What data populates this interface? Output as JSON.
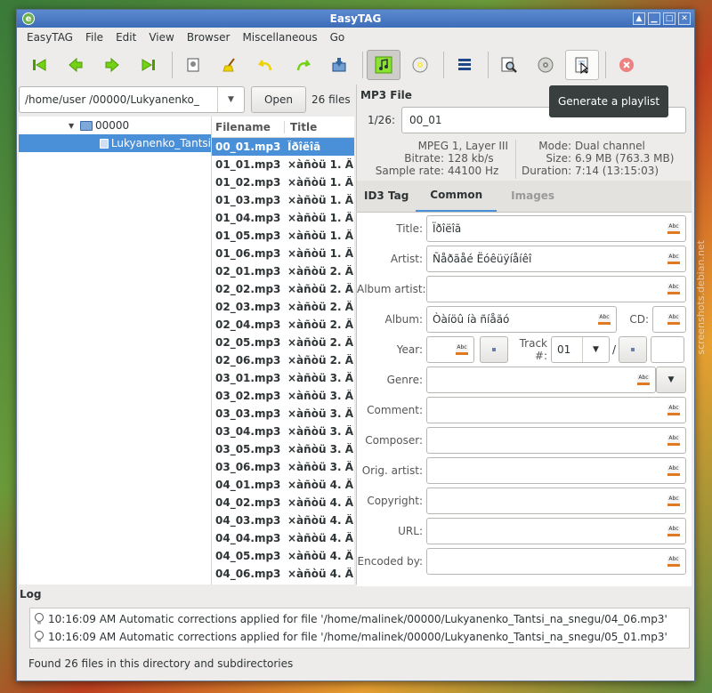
{
  "window": {
    "title": "EasyTAG",
    "app_icon_letter": "e"
  },
  "wm_buttons": {
    "up": "▲",
    "minimize": "▁",
    "maximize": "□",
    "close": "✕"
  },
  "menubar": [
    "EasyTAG",
    "File",
    "Edit",
    "View",
    "Browser",
    "Miscellaneous",
    "Go"
  ],
  "toolbar": {
    "icons": [
      "go-first-icon",
      "go-previous-icon",
      "go-next-icon",
      "go-last-icon",
      "scan-files-icon",
      "clear-icon",
      "undo-icon",
      "redo-icon",
      "save-icon",
      "view-artist-album-icon",
      "cddb-icon",
      "invert-selection-icon",
      "search-icon",
      "cd-icon",
      "playlist-icon",
      "stop-icon"
    ],
    "tooltip": "Generate a playlist"
  },
  "browser": {
    "path": "/home/user  /00000/Lukyanenko_",
    "open_label": "Open",
    "files_count": "26 files",
    "tree": [
      {
        "label": "00000",
        "expanded": true,
        "level": 0
      },
      {
        "label": "Lukyanenko_Tantsi",
        "level": 1,
        "selected": true
      }
    ],
    "list_headers": {
      "filename": "Filename",
      "title": "Title"
    },
    "files": [
      {
        "name": "00_01.mp3",
        "title": "Ïðîëîã",
        "selected": true
      },
      {
        "name": "01_01.mp3",
        "title": "×àñòü 1. Ä"
      },
      {
        "name": "01_02.mp3",
        "title": "×àñòü 1. Ä"
      },
      {
        "name": "01_03.mp3",
        "title": "×àñòü 1. Ä"
      },
      {
        "name": "01_04.mp3",
        "title": "×àñòü 1. Ä"
      },
      {
        "name": "01_05.mp3",
        "title": "×àñòü 1. Ä"
      },
      {
        "name": "01_06.mp3",
        "title": "×àñòü 1. Ä"
      },
      {
        "name": "02_01.mp3",
        "title": "×àñòü 2. Ä"
      },
      {
        "name": "02_02.mp3",
        "title": "×àñòü 2. Ä"
      },
      {
        "name": "02_03.mp3",
        "title": "×àñòü 2. Ä"
      },
      {
        "name": "02_04.mp3",
        "title": "×àñòü 2. Ä"
      },
      {
        "name": "02_05.mp3",
        "title": "×àñòü 2. Ä"
      },
      {
        "name": "02_06.mp3",
        "title": "×àñòü 2. Ä"
      },
      {
        "name": "03_01.mp3",
        "title": "×àñòü 3. Ä"
      },
      {
        "name": "03_02.mp3",
        "title": "×àñòü 3. Ä"
      },
      {
        "name": "03_03.mp3",
        "title": "×àñòü 3. Ä"
      },
      {
        "name": "03_04.mp3",
        "title": "×àñòü 3. Ä"
      },
      {
        "name": "03_05.mp3",
        "title": "×àñòü 3. Ä"
      },
      {
        "name": "03_06.mp3",
        "title": "×àñòü 3. Ä"
      },
      {
        "name": "04_01.mp3",
        "title": "×àñòü 4. Ä"
      },
      {
        "name": "04_02.mp3",
        "title": "×àñòü 4. Ä"
      },
      {
        "name": "04_03.mp3",
        "title": "×àñòü 4. Ä"
      },
      {
        "name": "04_04.mp3",
        "title": "×àñòü 4. Ä"
      },
      {
        "name": "04_05.mp3",
        "title": "×àñòü 4. Ä"
      },
      {
        "name": "04_06.mp3",
        "title": "×àñòü 4. Ä"
      }
    ]
  },
  "file_panel": {
    "heading": "MP3 File",
    "index_label": "1/26:",
    "index_value": "00_01",
    "info_left": [
      {
        "value": "MPEG 1, Layer III"
      },
      {
        "key": "Bitrate:",
        "value": "128 kb/s"
      },
      {
        "key": "Sample rate:",
        "value": "44100 Hz"
      }
    ],
    "info_right": [
      {
        "key": "Mode:",
        "value": "Dual channel"
      },
      {
        "key": "Size:",
        "value": "6.9 MB (763.3 MB)"
      },
      {
        "key": "Duration:",
        "value": "7:14 (13:15:03)"
      }
    ]
  },
  "tabs": [
    "ID3 Tag",
    "Common",
    "Images"
  ],
  "tag_fields": {
    "title_label": "Title:",
    "title_value": "Ïðîëîã",
    "artist_label": "Artist:",
    "artist_value": "Ñåðãåé Ëóêüÿíåíêî",
    "album_artist_label": "Album artist:",
    "album_artist_value": "",
    "album_label": "Album:",
    "album_value": "Òàíöû íà ñíåãó",
    "cd_label": "CD:",
    "cd_value": "",
    "year_label": "Year:",
    "year_value": "",
    "track_label": "Track #:",
    "track_value": "01",
    "track_sep": "/",
    "genre_label": "Genre:",
    "genre_value": "",
    "comment_label": "Comment:",
    "composer_label": "Composer:",
    "orig_artist_label": "Orig. artist:",
    "copyright_label": "Copyright:",
    "url_label": "URL:",
    "encoded_by_label": "Encoded by:",
    "abc_icon_text": "Abc"
  },
  "log": {
    "label": "Log",
    "entries": [
      "10:16:09 AM Automatic corrections applied for file '/home/malinek/00000/Lukyanenko_Tantsi_na_snegu/04_06.mp3'",
      "10:16:09 AM Automatic corrections applied for file '/home/malinek/00000/Lukyanenko_Tantsi_na_snegu/05_01.mp3'"
    ]
  },
  "status": "Found 26 files in this directory and subdirectories",
  "watermark": "screenshots.debian.net",
  "colors": {
    "selection": "#4a90d9",
    "titlebar": "#3e6db8",
    "accent_orange": "#e07a20"
  }
}
